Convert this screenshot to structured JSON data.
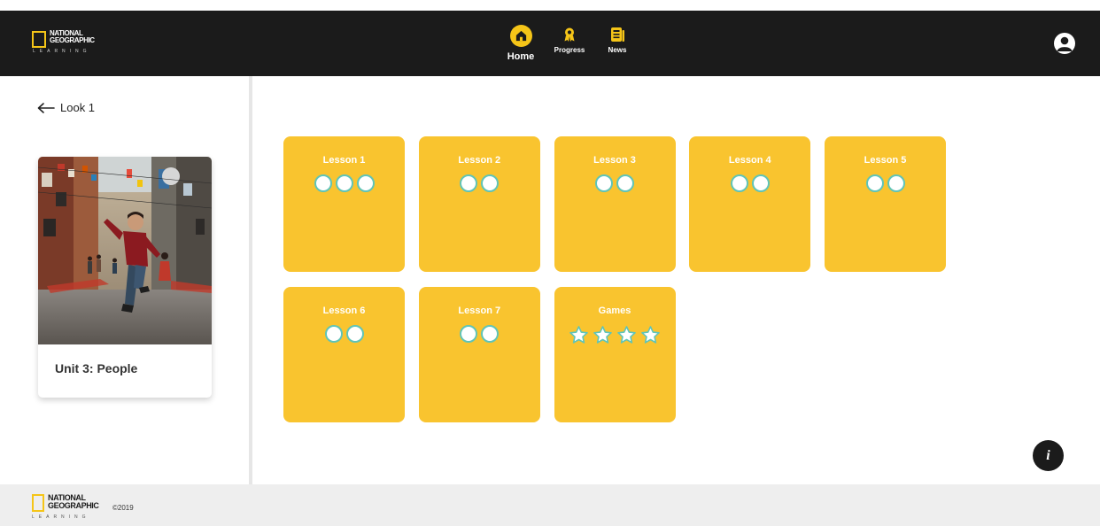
{
  "header": {
    "logo": {
      "line1": "NATIONAL",
      "line2": "GEOGRAPHIC",
      "line3": "LEARNING"
    },
    "nav": [
      {
        "label": "Home",
        "icon": "home-icon",
        "active": true
      },
      {
        "label": "Progress",
        "icon": "award-icon"
      },
      {
        "label": "News",
        "icon": "news-icon"
      }
    ],
    "user_icon": "user-avatar-icon"
  },
  "left_panel": {
    "back_label": "Look 1",
    "unit_card": {
      "title": "Unit 3: People"
    }
  },
  "tiles": [
    {
      "label": "Lesson 1",
      "marks": 3,
      "type": "circle"
    },
    {
      "label": "Lesson 2",
      "marks": 2,
      "type": "circle"
    },
    {
      "label": "Lesson 3",
      "marks": 2,
      "type": "circle"
    },
    {
      "label": "Lesson 4",
      "marks": 2,
      "type": "circle"
    },
    {
      "label": "Lesson 5",
      "marks": 2,
      "type": "circle"
    },
    {
      "label": "Lesson 6",
      "marks": 2,
      "type": "circle"
    },
    {
      "label": "Lesson 7",
      "marks": 2,
      "type": "circle"
    },
    {
      "label": "Games",
      "marks": 4,
      "type": "star"
    }
  ],
  "info_button": {
    "label": "i"
  },
  "footer": {
    "logo": {
      "line1": "NATIONAL",
      "line2": "GEOGRAPHIC",
      "line3": "LEARNING"
    },
    "copyright": "©2019"
  },
  "colors": {
    "tile": "#f9c42f",
    "accent": "#f5c518",
    "mark_border": "#5fc4b8",
    "header_bg": "#1b1b1b",
    "footer_bg": "#eeeeee"
  }
}
